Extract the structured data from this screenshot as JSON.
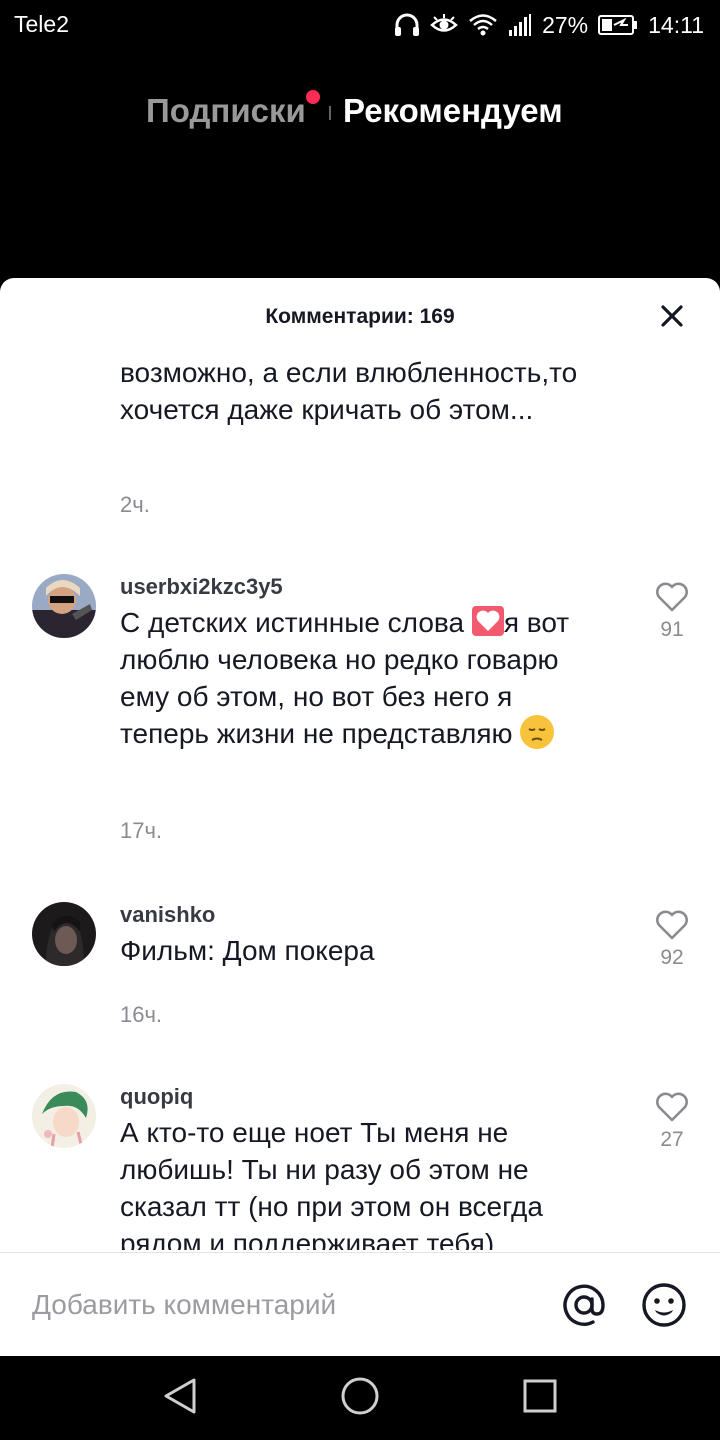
{
  "status_bar": {
    "carrier": "Tele2",
    "battery": "27%",
    "time": "14:11"
  },
  "feed_tabs": {
    "following": "Подписки",
    "for_you": "Рекомендуем"
  },
  "comments_sheet": {
    "title": "Комментарии: 169",
    "comments": [
      {
        "text": "возможно, а если влюбленность,то хочется даже кричать об этом...",
        "time": "2ч."
      },
      {
        "username": "userbxi2kzc3y5",
        "text_before": "С детских истинные слова ",
        "text_after": "я вот люблю человека но редко говарю ему об этом, но вот без него я теперь жизни не представляю ",
        "time": "17ч.",
        "likes": "91"
      },
      {
        "username": "vanishko",
        "text": "Фильм: Дом покера",
        "time": "16ч.",
        "likes": "92"
      },
      {
        "username": "quopiq",
        "text": "А кто-то еще ноет Ты меня не любишь! Ты ни разу об этом не сказал тт (но при этом он всегда рядом и поддерживает тебя)",
        "likes": "27"
      }
    ]
  },
  "input_bar": {
    "placeholder": "Добавить комментарий"
  },
  "icons": {
    "close": "close-icon",
    "like": "heart-outline-icon",
    "mention": "at-icon",
    "emoji": "smiley-icon",
    "back": "triangle-back-icon",
    "home": "circle-home-icon",
    "recents": "square-recents-icon"
  },
  "colors": {
    "accent_dot": "#fe2c55",
    "secondary_text": "#8a8b91"
  }
}
